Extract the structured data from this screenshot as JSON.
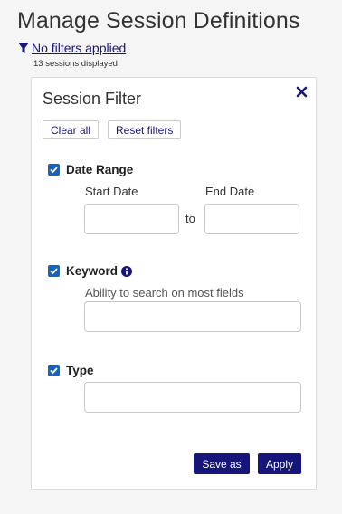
{
  "page": {
    "title": "Manage Session Definitions",
    "filter_link": "No filters applied",
    "sessions_count": "13 sessions displayed"
  },
  "panel": {
    "title": "Session Filter",
    "clear_all": "Clear all",
    "reset_filters": "Reset filters",
    "date_range": {
      "label": "Date Range",
      "checked": true,
      "start_label": "Start Date",
      "end_label": "End Date",
      "start_value": "",
      "end_value": "",
      "separator": "to"
    },
    "keyword": {
      "label": "Keyword",
      "checked": true,
      "hint": "Ability to search on most fields",
      "value": ""
    },
    "type": {
      "label": "Type",
      "checked": true,
      "value": ""
    },
    "save_as": "Save as",
    "apply": "Apply"
  },
  "colors": {
    "primary": "#16157a",
    "checkbox": "#1565c0",
    "background": "#f5f5f5"
  },
  "icons": [
    "funnel-icon",
    "close-icon",
    "info-icon",
    "checkmark-icon"
  ]
}
